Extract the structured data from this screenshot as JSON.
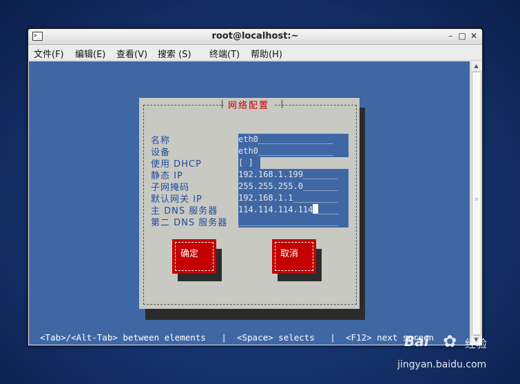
{
  "window": {
    "title": "root@localhost:~",
    "menu": [
      "文件(F)",
      "编辑(E)",
      "查看(V)",
      "搜索 (S)",
      "终端(T)",
      "帮助(H)"
    ]
  },
  "dialog": {
    "title": "网络配置",
    "fields": [
      {
        "label": "名称",
        "value": "eth0_______________"
      },
      {
        "label": "设备",
        "value": "eth0_______________"
      },
      {
        "label": "使用 DHCP",
        "value": "[ ]"
      },
      {
        "label": "静态 IP",
        "value": "192.168.1.199_______"
      },
      {
        "label": "子网掩码",
        "value": "255.255.255.0_______"
      },
      {
        "label": "默认网关 IP",
        "value": "192.168.1.1_________"
      },
      {
        "label": "主 DNS 服务器",
        "value": "114.114.114.114"
      },
      {
        "label": "第二 DNS 服务器",
        "value": "____________________"
      }
    ],
    "primary_dns_tail": "____",
    "ok_label": "确定",
    "cancel_label": "取消"
  },
  "status_line": "<Tab>/<Alt-Tab> between elements   |  <Space> selects   |  <F12> next screen",
  "watermark": {
    "brand": "Bai",
    "suffix": "经验",
    "url": "jingyan.baidu.com"
  },
  "colors": {
    "terminal_bg": "#3f67a4",
    "dialog_bg": "#c9c9c4",
    "button": "#c40000",
    "title_text": "#c00000"
  }
}
